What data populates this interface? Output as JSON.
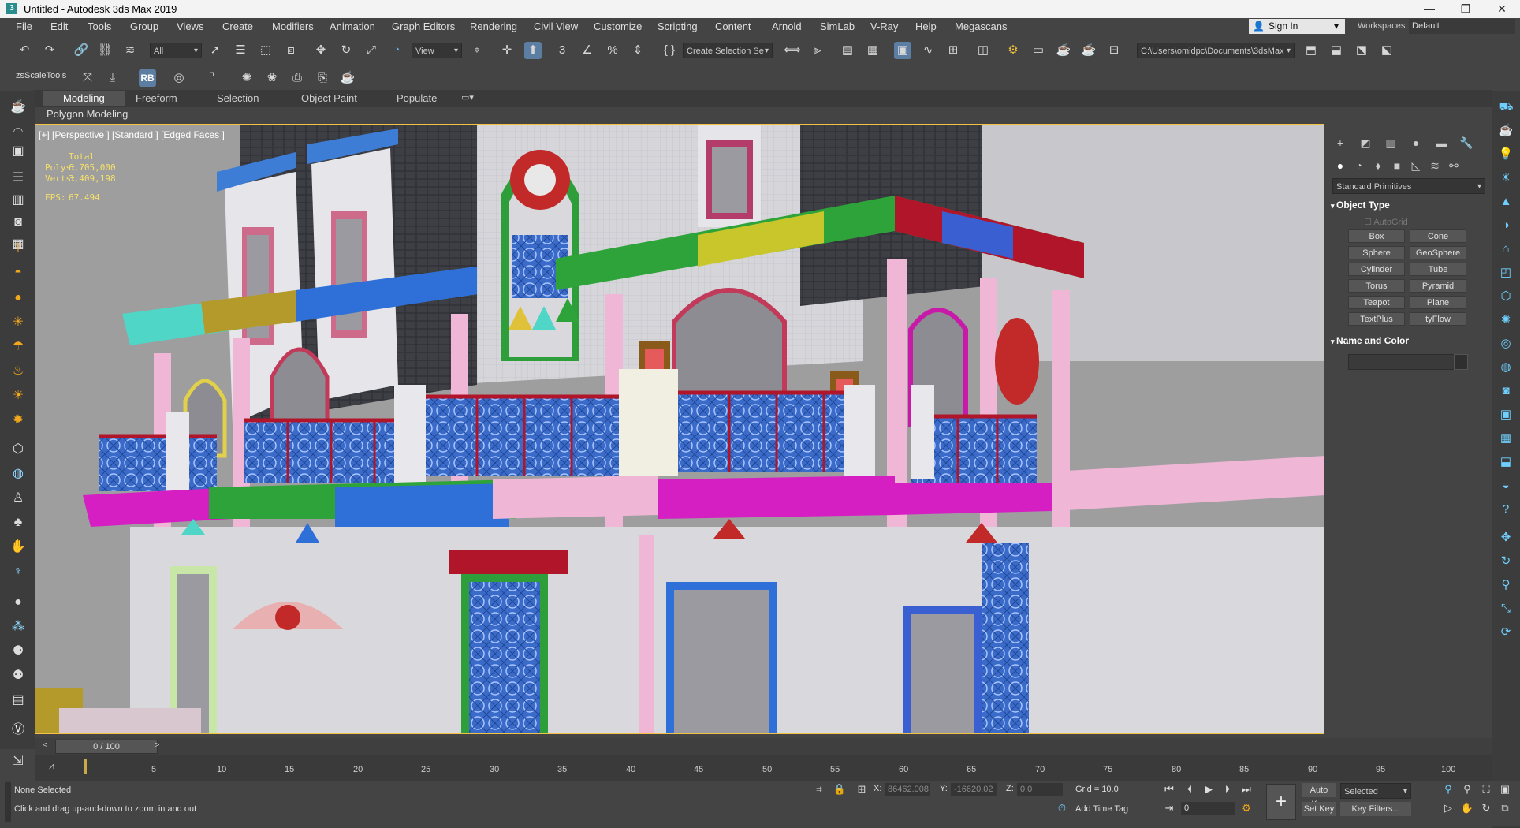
{
  "window": {
    "title": "Untitled - Autodesk 3ds Max 2019",
    "app_icon_letter": "3",
    "controls": [
      "—",
      "❐",
      "✕"
    ]
  },
  "menubar": {
    "items": [
      "File",
      "Edit",
      "Tools",
      "Group",
      "Views",
      "Create",
      "Modifiers",
      "Animation",
      "Graph Editors",
      "Rendering",
      "Civil View",
      "Customize",
      "Scripting",
      "Content",
      "Arnold",
      "SimLab",
      "V-Ray",
      "Help",
      "Megascans"
    ],
    "sign_in": "Sign In",
    "workspaces_label": "Workspaces:",
    "workspace_value": "Default"
  },
  "main_toolbar": {
    "selection_filter": "All",
    "ref_coord": "View",
    "named_selection": "Create Selection Se",
    "project_path": "C:\\Users\\omidpc\\Documents\\3dsMax"
  },
  "toolbar2": {
    "label": "zsScaleTools",
    "rb_label": "RB"
  },
  "ribbon": {
    "tabs": [
      "Modeling",
      "Freeform",
      "Selection",
      "Object Paint",
      "Populate"
    ],
    "active_tab": "Modeling",
    "panel_label": "Polygon Modeling"
  },
  "viewport": {
    "label": "[+] [Perspective ] [Standard ] [Edged Faces ]",
    "stats": {
      "total_label": "Total",
      "polys_label": "Polys:",
      "polys_value": "6,705,000",
      "verts_label": "Verts:",
      "verts_value": "3,409,198",
      "fps_label": "FPS:",
      "fps_value": "67.494"
    }
  },
  "command_panel": {
    "category": "Standard Primitives",
    "object_type_title": "Object Type",
    "autogrid": "AutoGrid",
    "buttons": [
      "Box",
      "Cone",
      "Sphere",
      "GeoSphere",
      "Cylinder",
      "Tube",
      "Torus",
      "Pyramid",
      "Teapot",
      "Plane",
      "TextPlus",
      "tyFlow"
    ],
    "name_color_title": "Name and Color"
  },
  "timeline": {
    "frame_display": "0 / 100",
    "ticks": [
      "5",
      "10",
      "15",
      "20",
      "25",
      "30",
      "35",
      "40",
      "45",
      "50",
      "55",
      "60",
      "65",
      "70",
      "75",
      "80",
      "85",
      "90",
      "95",
      "100"
    ]
  },
  "status": {
    "selection": "None Selected",
    "prompt": "Click and drag up-and-down to zoom in and out",
    "x_label": "X:",
    "x_value": "86462.008",
    "y_label": "Y:",
    "y_value": "-16620.02",
    "z_label": "Z:",
    "z_value": "0.0",
    "grid": "Grid = 10.0",
    "add_time_tag": "Add Time Tag",
    "auto_key": "Auto Key",
    "set_key": "Set Key",
    "key_mode": "Selected",
    "key_filters": "Key Filters...",
    "current_frame": "0"
  },
  "colors": {
    "viewport_border": "#f3c245",
    "active_tool": "#5d7ea3",
    "stats_text": "#f5e06a"
  }
}
